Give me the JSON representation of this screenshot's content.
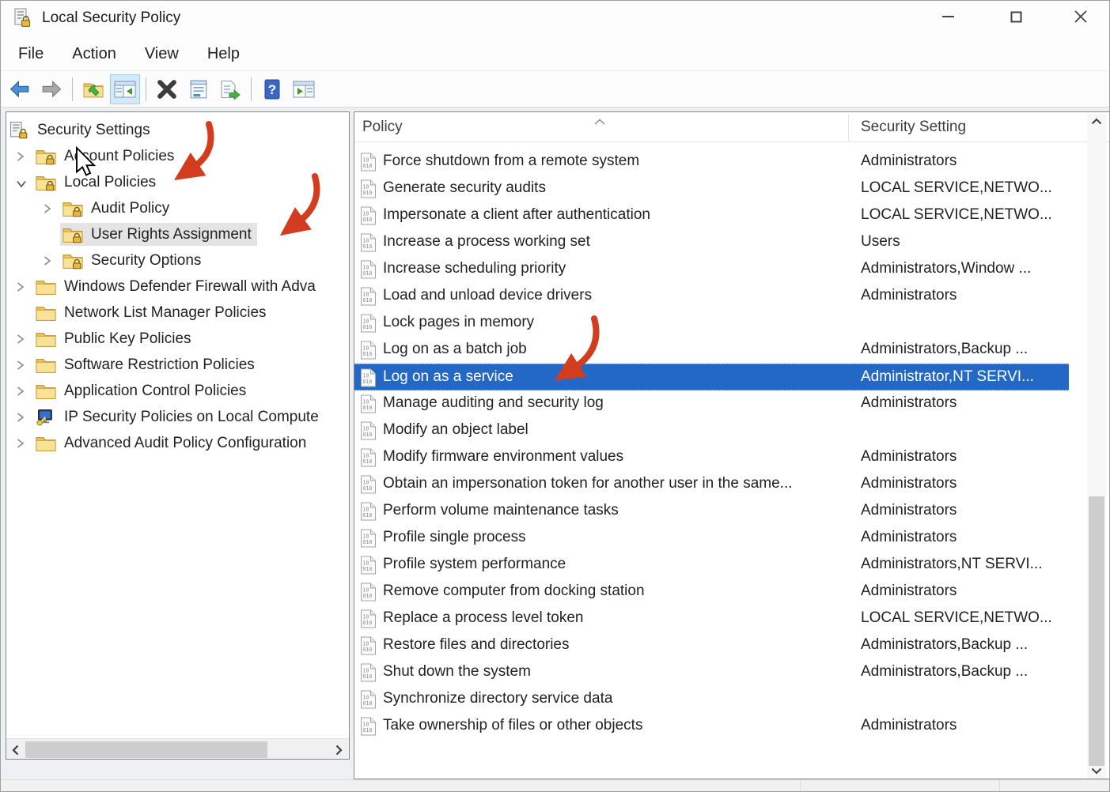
{
  "window": {
    "title": "Local Security Policy"
  },
  "menu": {
    "items": [
      "File",
      "Action",
      "View",
      "Help"
    ]
  },
  "toolbar": {
    "buttons": [
      {
        "name": "back"
      },
      {
        "name": "forward"
      },
      {
        "name": "up-one-level"
      },
      {
        "name": "show-hide-console-tree",
        "active": true
      },
      {
        "name": "delete"
      },
      {
        "name": "properties"
      },
      {
        "name": "export-list"
      },
      {
        "name": "help"
      },
      {
        "name": "show-hide-action-pane"
      }
    ]
  },
  "tree": {
    "items": [
      {
        "label": "Security Settings",
        "level": 0,
        "icon": "security-root",
        "chevron": "none",
        "selected": false
      },
      {
        "label": "Account Policies",
        "level": 1,
        "icon": "folder-lock",
        "chevron": "collapsed",
        "selected": false
      },
      {
        "label": "Local Policies",
        "level": 1,
        "icon": "folder-lock",
        "chevron": "expanded",
        "selected": false
      },
      {
        "label": "Audit Policy",
        "level": 2,
        "icon": "folder-lock",
        "chevron": "collapsed",
        "selected": false
      },
      {
        "label": "User Rights Assignment",
        "level": 2,
        "icon": "folder-lock",
        "chevron": "none",
        "selected": true
      },
      {
        "label": "Security Options",
        "level": 2,
        "icon": "folder-lock",
        "chevron": "collapsed",
        "selected": false
      },
      {
        "label": "Windows Defender Firewall with Adva",
        "level": 1,
        "icon": "folder",
        "chevron": "collapsed",
        "selected": false
      },
      {
        "label": "Network List Manager Policies",
        "level": 1,
        "icon": "folder",
        "chevron": "none",
        "selected": false
      },
      {
        "label": "Public Key Policies",
        "level": 1,
        "icon": "folder",
        "chevron": "collapsed",
        "selected": false
      },
      {
        "label": "Software Restriction Policies",
        "level": 1,
        "icon": "folder",
        "chevron": "collapsed",
        "selected": false
      },
      {
        "label": "Application Control Policies",
        "level": 1,
        "icon": "folder",
        "chevron": "collapsed",
        "selected": false
      },
      {
        "label": "IP Security Policies on Local Compute",
        "level": 1,
        "icon": "ip-security",
        "chevron": "collapsed",
        "selected": false
      },
      {
        "label": "Advanced Audit Policy Configuration",
        "level": 1,
        "icon": "folder",
        "chevron": "collapsed",
        "selected": false
      }
    ]
  },
  "list": {
    "columns": [
      "Policy",
      "Security Setting"
    ],
    "sort_indicator": "ascending",
    "rows": [
      {
        "policy": "Force shutdown from a remote system",
        "setting": "Administrators",
        "selected": false
      },
      {
        "policy": "Generate security audits",
        "setting": "LOCAL SERVICE,NETWO...",
        "selected": false
      },
      {
        "policy": "Impersonate a client after authentication",
        "setting": "LOCAL SERVICE,NETWO...",
        "selected": false
      },
      {
        "policy": "Increase a process working set",
        "setting": "Users",
        "selected": false
      },
      {
        "policy": "Increase scheduling priority",
        "setting": "Administrators,Window ...",
        "selected": false
      },
      {
        "policy": "Load and unload device drivers",
        "setting": "Administrators",
        "selected": false
      },
      {
        "policy": "Lock pages in memory",
        "setting": "",
        "selected": false
      },
      {
        "policy": "Log on as a batch job",
        "setting": "Administrators,Backup ...",
        "selected": false
      },
      {
        "policy": "Log on as a service",
        "setting": "Administrator,NT SERVI...",
        "selected": true
      },
      {
        "policy": "Manage auditing and security log",
        "setting": "Administrators",
        "selected": false
      },
      {
        "policy": "Modify an object label",
        "setting": "",
        "selected": false
      },
      {
        "policy": "Modify firmware environment values",
        "setting": "Administrators",
        "selected": false
      },
      {
        "policy": "Obtain an impersonation token for another user in the same...",
        "setting": "Administrators",
        "selected": false
      },
      {
        "policy": "Perform volume maintenance tasks",
        "setting": "Administrators",
        "selected": false
      },
      {
        "policy": "Profile single process",
        "setting": "Administrators",
        "selected": false
      },
      {
        "policy": "Profile system performance",
        "setting": "Administrators,NT SERVI...",
        "selected": false
      },
      {
        "policy": "Remove computer from docking station",
        "setting": "Administrators",
        "selected": false
      },
      {
        "policy": "Replace a process level token",
        "setting": "LOCAL SERVICE,NETWO...",
        "selected": false
      },
      {
        "policy": "Restore files and directories",
        "setting": "Administrators,Backup ...",
        "selected": false
      },
      {
        "policy": "Shut down the system",
        "setting": "Administrators,Backup ...",
        "selected": false
      },
      {
        "policy": "Synchronize directory service data",
        "setting": "",
        "selected": false
      },
      {
        "policy": "Take ownership of files or other objects",
        "setting": "Administrators",
        "selected": false
      }
    ]
  },
  "annotations": {
    "arrows": [
      {
        "target": "Local Policies"
      },
      {
        "target": "User Rights Assignment"
      },
      {
        "target": "Log on as a service"
      }
    ],
    "cursor_near": "Account Policies"
  },
  "colors": {
    "selection_blue": "#2368c4",
    "tree_selection_gray": "#e4e4e4",
    "annotation_red": "#d23d1f",
    "folder_yellow": "#f7e296"
  }
}
